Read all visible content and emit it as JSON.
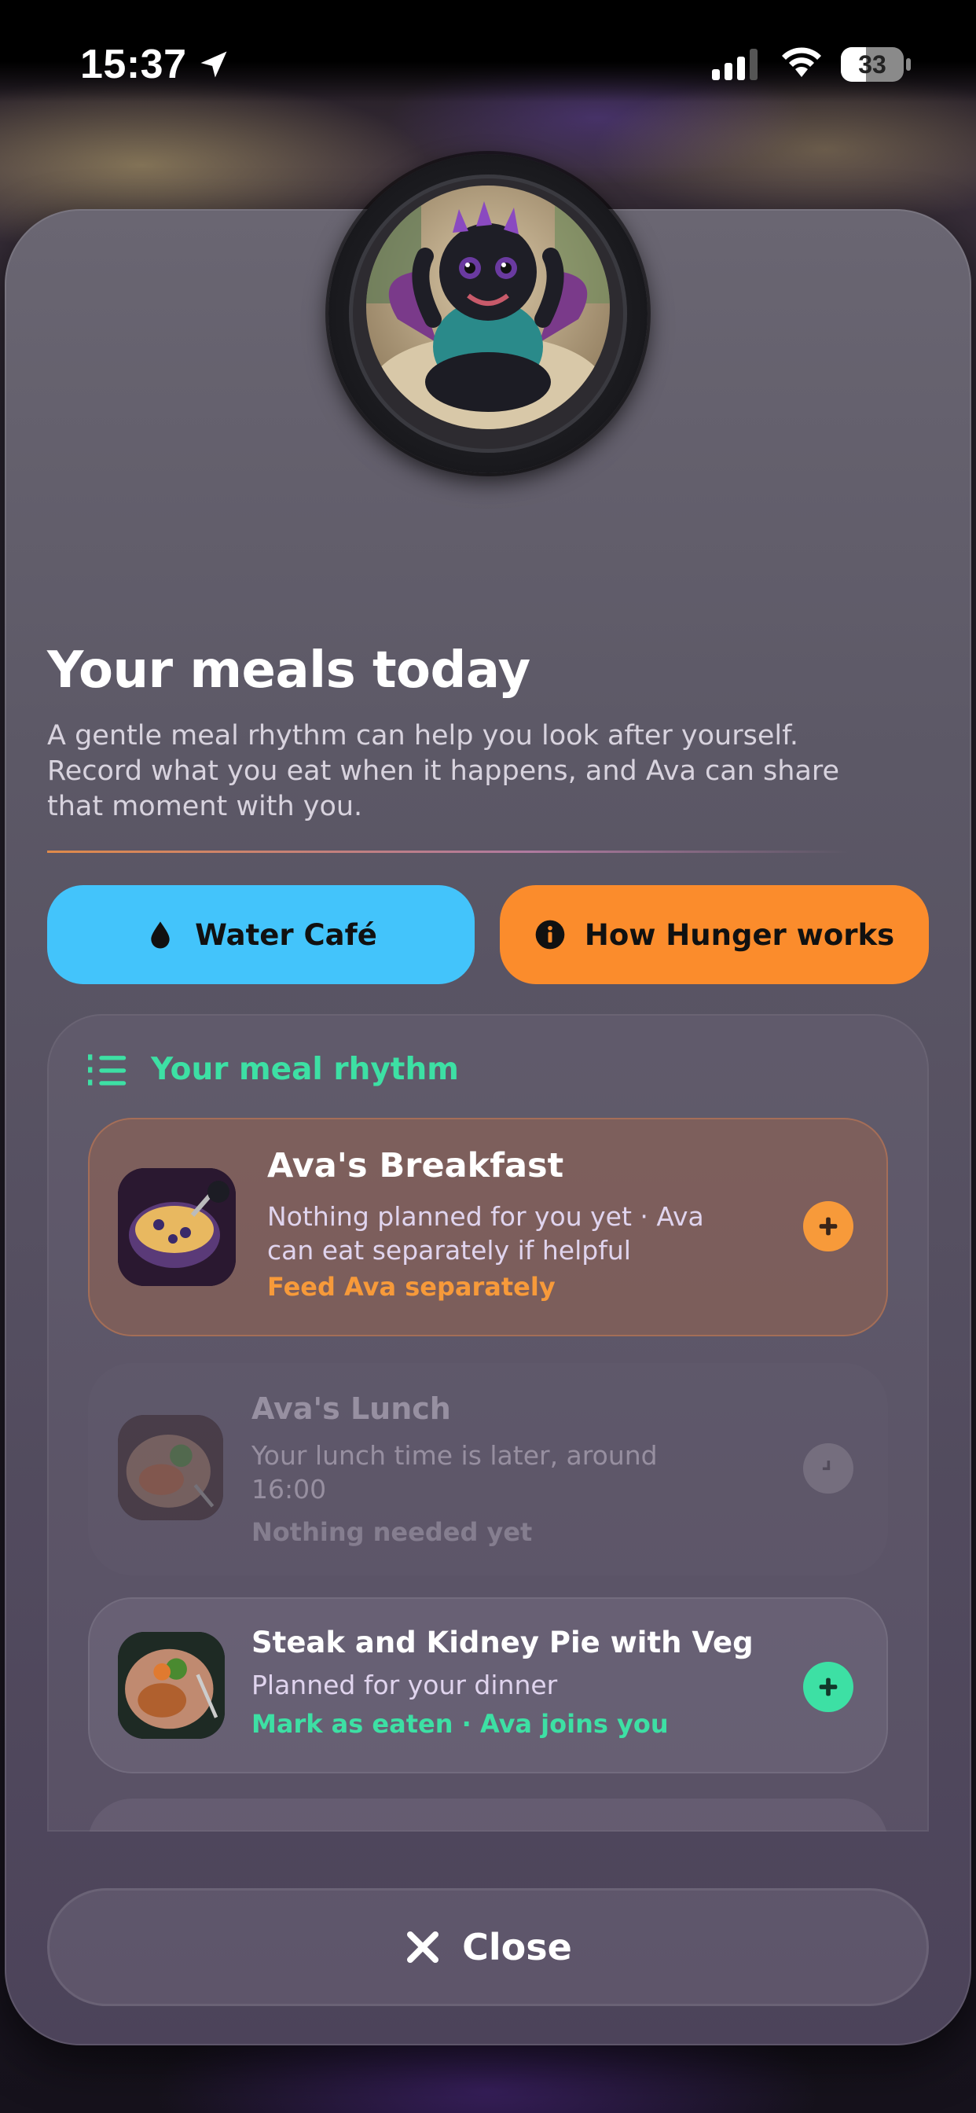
{
  "status_bar": {
    "time": "15:37",
    "battery": "33"
  },
  "title": "Your meals today",
  "subtitle": "A gentle meal rhythm can help you look after yourself. Record what you eat when it happens, and Ava can share that moment with you.",
  "buttons": {
    "water": "Water Café",
    "hunger": "How Hunger works"
  },
  "rhythm": {
    "heading": "Your meal rhythm",
    "meals": [
      {
        "title": "Ava's Breakfast",
        "desc": "Nothing planned for you yet · Ava can eat separately if helpful",
        "cta": "Feed Ava separately",
        "state": "active"
      },
      {
        "title": "Ava's Lunch",
        "desc": "Your lunch time is later, around 16:00",
        "cta": "Nothing needed yet",
        "state": "disabled"
      },
      {
        "title": "Steak and Kidney Pie with Veg",
        "desc": "Planned for your dinner",
        "cta": "Mark as eaten · Ava joins you",
        "state": "planned"
      }
    ]
  },
  "close_label": "Close",
  "colors": {
    "water": "#43c4fb",
    "hunger": "#fb8c2c",
    "accent_green": "#3de0a4",
    "accent_orange": "#f79a3a"
  }
}
